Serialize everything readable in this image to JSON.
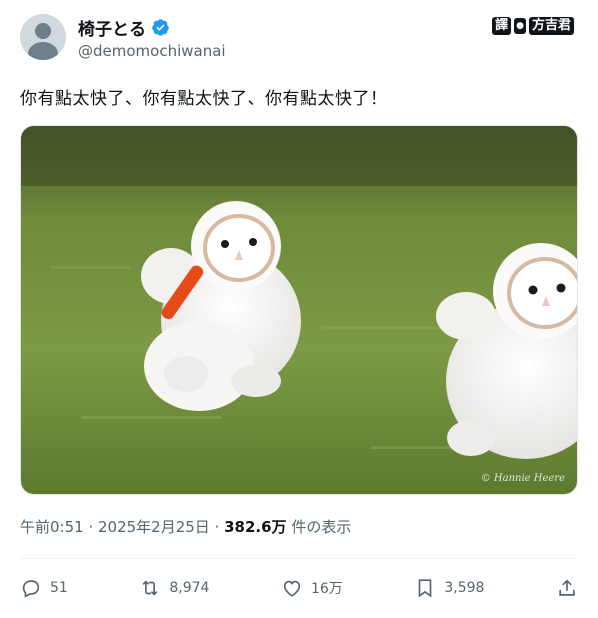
{
  "user": {
    "display_name": "椅子とる",
    "handle": "@demomochiwanai"
  },
  "watermark": {
    "left": "譯",
    "right": "方吉君"
  },
  "tweet": {
    "text": "你有點太快了、你有點太快了、你有點太快了！",
    "photo_credit": "© Hannie Heere"
  },
  "meta": {
    "time": "午前0:51 · 2025年2月25日 · ",
    "views": "382.6万",
    "views_label": " 件の表示"
  },
  "actions": {
    "replies": "51",
    "retweets": "8,974",
    "likes": "16万",
    "bookmarks": "3,598"
  },
  "colors": {
    "verified": "#1d9bf0",
    "muted": "#536471",
    "text": "#0f1419"
  }
}
